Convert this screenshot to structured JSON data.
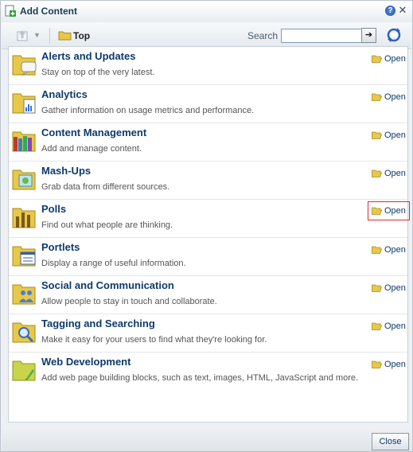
{
  "dialog": {
    "title": "Add Content",
    "help_symbol": "?",
    "close_symbol": "✕"
  },
  "toolbar": {
    "dropdown_symbol": "▼",
    "location_label": "Top",
    "search_label": "Search",
    "search_value": "",
    "go_symbol": "➔"
  },
  "items": [
    {
      "title": "Alerts and Updates",
      "description": "Stay on top of the very latest.",
      "open_label": "Open",
      "icon": "folder-alerts-icon"
    },
    {
      "title": "Analytics",
      "description": "Gather information on usage metrics and performance.",
      "open_label": "Open",
      "icon": "folder-analytics-icon"
    },
    {
      "title": "Content Management",
      "description": "Add and manage content.",
      "open_label": "Open",
      "icon": "folder-content-icon"
    },
    {
      "title": "Mash-Ups",
      "description": "Grab data from different sources.",
      "open_label": "Open",
      "icon": "folder-mashups-icon"
    },
    {
      "title": "Polls",
      "description": "Find out what people are thinking.",
      "open_label": "Open",
      "icon": "folder-polls-icon"
    },
    {
      "title": "Portlets",
      "description": "Display a range of useful information.",
      "open_label": "Open",
      "icon": "folder-portlets-icon"
    },
    {
      "title": "Social and Communication",
      "description": "Allow people to stay in touch and collaborate.",
      "open_label": "Open",
      "icon": "folder-social-icon"
    },
    {
      "title": "Tagging and Searching",
      "description": "Make it easy for your users to find what they're looking for.",
      "open_label": "Open",
      "icon": "folder-tagging-icon"
    },
    {
      "title": "Web Development",
      "description": "Add web page building blocks, such as text, images, HTML, JavaScript and more.",
      "open_label": "Open",
      "icon": "folder-webdev-icon"
    }
  ],
  "footer": {
    "close_label": "Close"
  },
  "colors": {
    "title_text": "#0d3a6c",
    "highlight": "#d32f2f",
    "folder": "#e8c84a"
  }
}
